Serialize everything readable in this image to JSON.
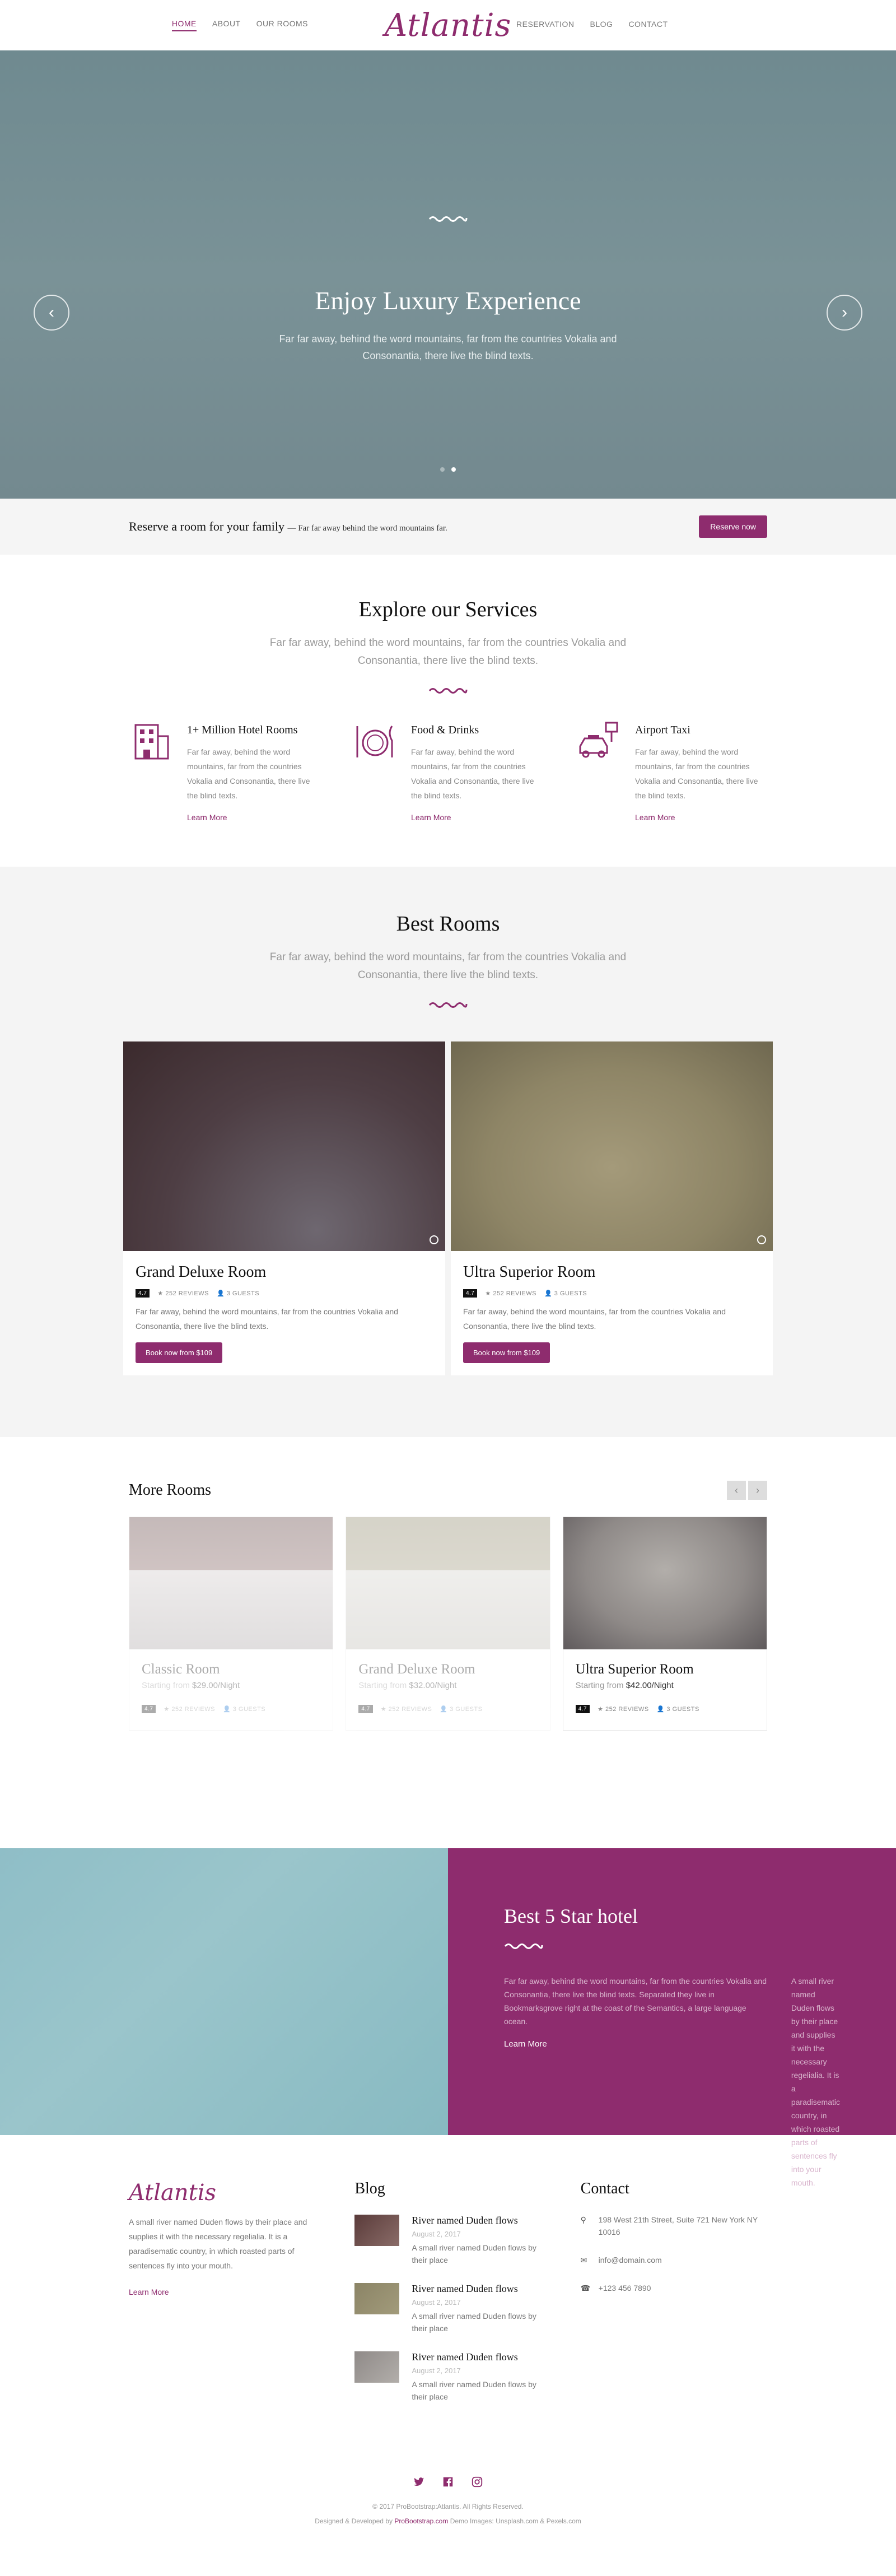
{
  "nav": {
    "left": [
      "Home",
      "About",
      "Our Rooms"
    ],
    "right": [
      "Reservation",
      "Blog",
      "Contact"
    ],
    "logo": "Atlantis"
  },
  "hero": {
    "title": "Enjoy Luxury Experience",
    "text": "Far far away, behind the word mountains, far from the countries Vokalia and Consonantia, there live the blind texts."
  },
  "reserve": {
    "headline": "Reserve a room for your family",
    "sub": "— Far far away behind the word mountains far.",
    "button": "Reserve now"
  },
  "services": {
    "title": "Explore our Services",
    "subtitle": "Far far away, behind the word mountains, far from the countries Vokalia and Consonantia, there live the blind texts.",
    "items": [
      {
        "title": "1+ Million Hotel Rooms",
        "text": "Far far away, behind the word mountains, far from the countries Vokalia and Consonantia, there live the blind texts.",
        "link": "Learn More",
        "icon": "hotel-building-icon"
      },
      {
        "title": "Food & Drinks",
        "text": "Far far away, behind the word mountains, far from the countries Vokalia and Consonantia, there live the blind texts.",
        "link": "Learn More",
        "icon": "plate-cutlery-icon"
      },
      {
        "title": "Airport Taxi",
        "text": "Far far away, behind the word mountains, far from the countries Vokalia and Consonantia, there live the blind texts.",
        "link": "Learn More",
        "icon": "taxi-icon"
      }
    ]
  },
  "best": {
    "title": "Best Rooms",
    "subtitle": "Far far away, behind the word mountains, far from the countries Vokalia and Consonantia, there live the blind texts.",
    "rooms": [
      {
        "name": "Grand Deluxe Room",
        "rating": "4.7",
        "reviews": "252 REVIEWS",
        "guests": "3 GUESTS",
        "text": "Far far away, behind the word mountains, far from the countries Vokalia and Consonantia, there live the blind texts.",
        "button": "Book now from $109"
      },
      {
        "name": "Ultra Superior Room",
        "rating": "4.7",
        "reviews": "252 REVIEWS",
        "guests": "3 GUESTS",
        "text": "Far far away, behind the word mountains, far from the countries Vokalia and Consonantia, there live the blind texts.",
        "button": "Book now from $109"
      }
    ]
  },
  "more": {
    "title": "More Rooms",
    "rooms": [
      {
        "name": "Classic Room",
        "price_label": "Starting from",
        "price": "$29.00/Night",
        "rating": "4.7",
        "reviews": "252 REVIEWS",
        "guests": "3 GUESTS"
      },
      {
        "name": "Grand Deluxe Room",
        "price_label": "Starting from",
        "price": "$32.00/Night",
        "rating": "4.7",
        "reviews": "252 REVIEWS",
        "guests": "3 GUESTS"
      },
      {
        "name": "Ultra Superior Room",
        "price_label": "Starting from",
        "price": "$42.00/Night",
        "rating": "4.7",
        "reviews": "252 REVIEWS",
        "guests": "3 GUESTS"
      }
    ]
  },
  "feature": {
    "title": "Best 5 Star hotel",
    "col1": "Far far away, behind the word mountains, far from the countries Vokalia and Consonantia, there live the blind texts. Separated they live in Bookmarksgrove right at the coast of the Semantics, a large language ocean.",
    "col2": "A small river named Duden flows by their place and supplies it with the necessary regelialia. It is a paradisematic country, in which roasted parts of sentences fly into your mouth.",
    "link": "Learn More"
  },
  "footer": {
    "logo": "Atlantis",
    "about": "A small river named Duden flows by their place and supplies it with the necessary regelialia. It is a paradisematic country, in which roasted parts of sentences fly into your mouth.",
    "about_link": "Learn More",
    "blog_title": "Blog",
    "blog": [
      {
        "title": "River named Duden flows",
        "date": "August 2, 2017",
        "text": "A small river named Duden flows by their place"
      },
      {
        "title": "River named Duden flows",
        "date": "August 2, 2017",
        "text": "A small river named Duden flows by their place"
      },
      {
        "title": "River named Duden flows",
        "date": "August 2, 2017",
        "text": "A small river named Duden flows by their place"
      }
    ],
    "contact_title": "Contact",
    "address": "198 West 21th Street, Suite 721 New York NY 10016",
    "email": "info@domain.com",
    "phone": "+123 456 7890",
    "copyright": "© 2017 ProBootstrap:Atlantis. All Rights Reserved.",
    "credits_pre": "Designed & Developed by",
    "credits_link": "ProBootstrap.com",
    "credits_post": "Demo Images: Unsplash.com & Pexels.com"
  },
  "colors": {
    "accent": "#8e2c6e"
  }
}
